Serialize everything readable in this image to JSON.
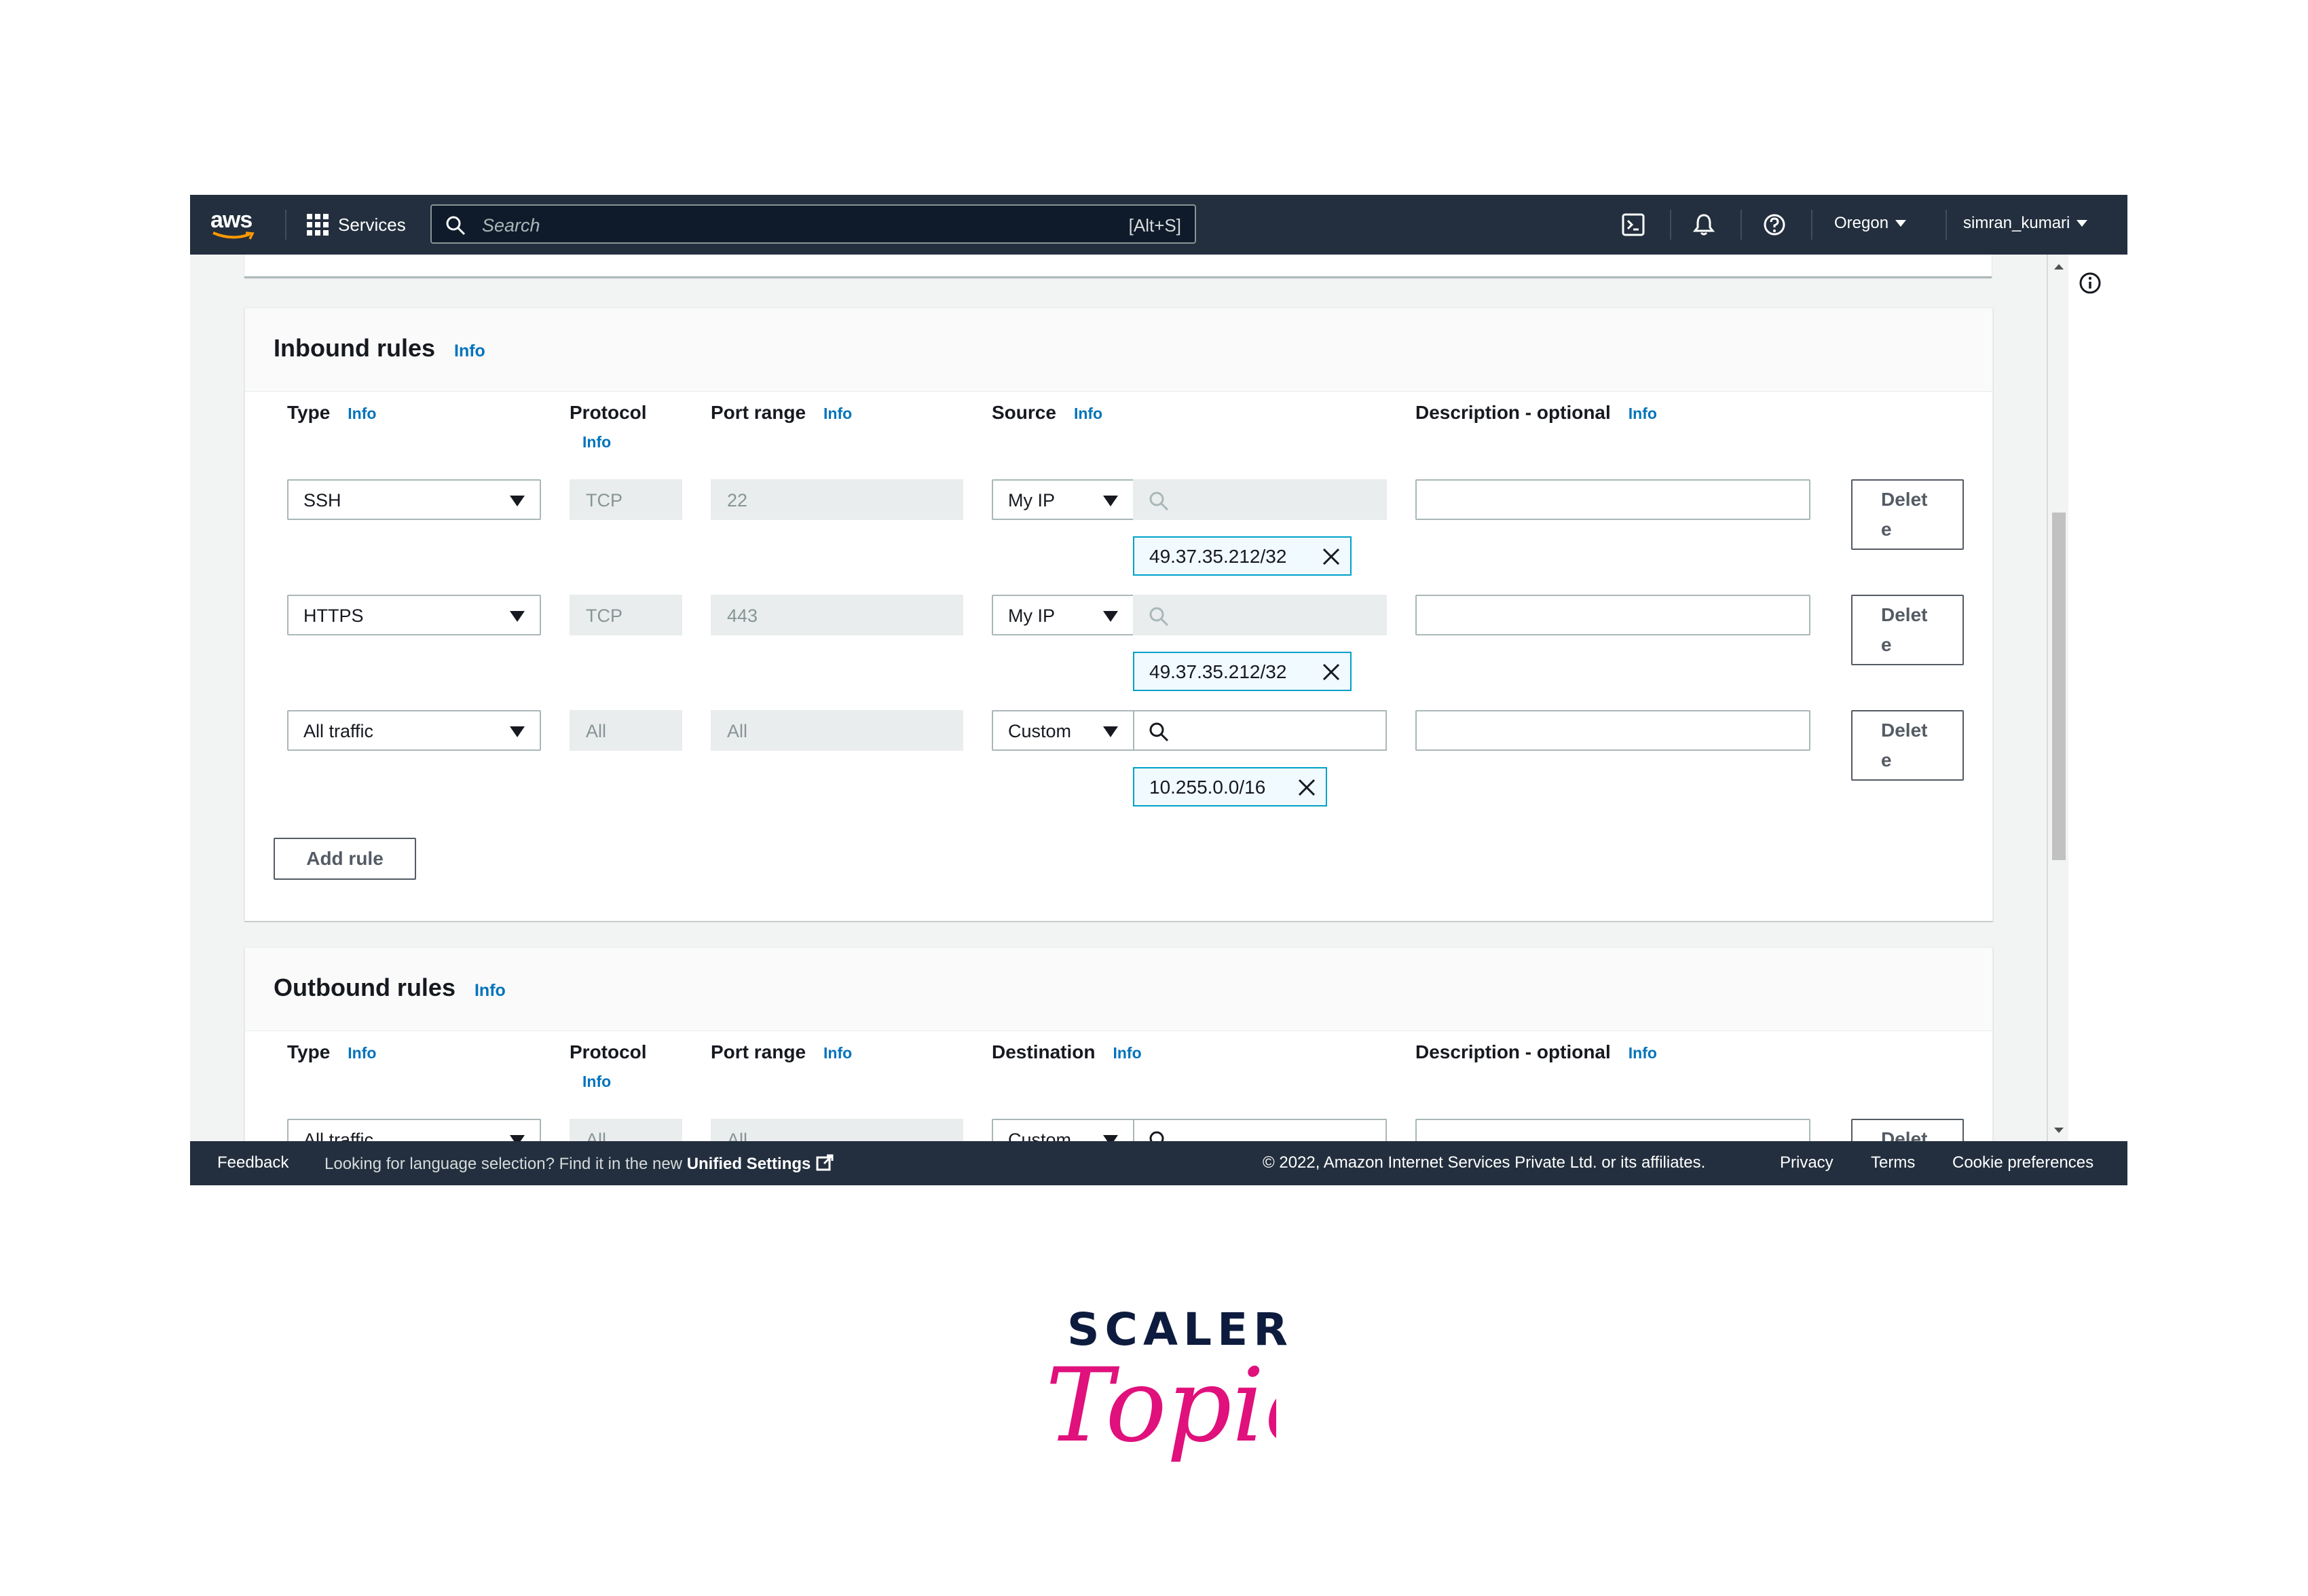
{
  "nav": {
    "logo_text": "aws",
    "services_label": "Services",
    "search_placeholder": "Search",
    "search_shortcut": "[Alt+S]",
    "region": "Oregon",
    "user": "simran_kumari",
    "icons": [
      "cloudshell-icon",
      "bell-icon",
      "help-icon"
    ]
  },
  "inbound": {
    "title": "Inbound rules",
    "info": "Info",
    "columns": {
      "type": "Type",
      "protocol": "Protocol",
      "port_range": "Port range",
      "source": "Source",
      "description": "Description - optional",
      "info": "Info"
    },
    "rules": [
      {
        "type": "SSH",
        "protocol": "TCP",
        "port": "22",
        "source_type": "My IP",
        "token": "49.37.35.212/32",
        "delete_l1": "Delet",
        "delete_l2": "e"
      },
      {
        "type": "HTTPS",
        "protocol": "TCP",
        "port": "443",
        "source_type": "My IP",
        "token": "49.37.35.212/32",
        "delete_l1": "Delet",
        "delete_l2": "e"
      },
      {
        "type": "All traffic",
        "protocol": "All",
        "port": "All",
        "source_type": "Custom",
        "token": "10.255.0.0/16",
        "delete_l1": "Delet",
        "delete_l2": "e"
      }
    ],
    "add_rule": "Add rule"
  },
  "outbound": {
    "title": "Outbound rules",
    "info": "Info",
    "columns": {
      "type": "Type",
      "protocol": "Protocol",
      "port_range": "Port range",
      "destination": "Destination",
      "description": "Description - optional",
      "info": "Info"
    },
    "rule": {
      "type": "All traffic",
      "protocol": "All",
      "port": "All",
      "dest_type": "Custom",
      "delete_l1": "Delet"
    }
  },
  "footer": {
    "feedback": "Feedback",
    "language_text": "Looking for language selection? Find it in the new",
    "unified_settings": "Unified Settings",
    "copyright": "© 2022, Amazon Internet Services Private Ltd. or its affiliates.",
    "privacy": "Privacy",
    "terms": "Terms",
    "cookie": "Cookie preferences"
  },
  "watermark": {
    "line1": "SCALER",
    "line2": "Topics"
  },
  "colors": {
    "nav_bg": "#232f3e",
    "info_link": "#0073bb",
    "token_border": "#00a1c9",
    "scaler_navy": "#0d1b3e",
    "scaler_pink": "#e0107c"
  }
}
